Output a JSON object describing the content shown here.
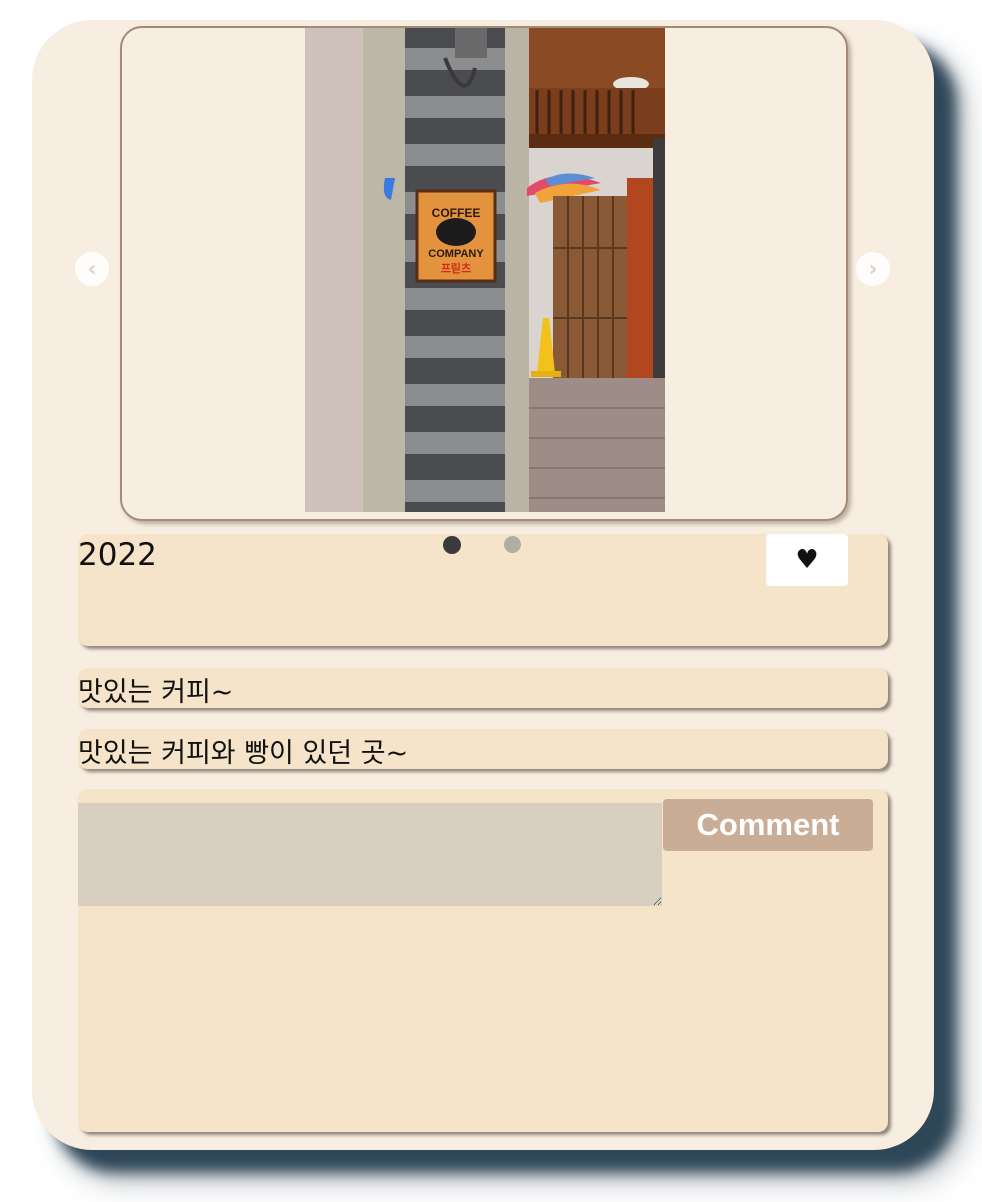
{
  "carousel": {
    "prev_symbol": "‹",
    "next_symbol": "›",
    "active_slide": 1,
    "slide_count": 2,
    "photo": {
      "sign_lines": [
        "COFFEE",
        "COMPANY",
        "프릳츠"
      ]
    }
  },
  "post": {
    "year": "2022",
    "like_symbol": "♥",
    "title": "맛있는 커피~",
    "description": "맛있는 커피와 빵이 있던 곳~"
  },
  "comments": {
    "input_value": "",
    "input_placeholder": "",
    "button_label": "Comment"
  },
  "colors": {
    "card_bg": "#f8ede1",
    "panel_bg": "#f5e4c9",
    "button_bg": "#c9ad96",
    "input_bg": "#d9cfc0",
    "shadow": "#2e4758"
  }
}
